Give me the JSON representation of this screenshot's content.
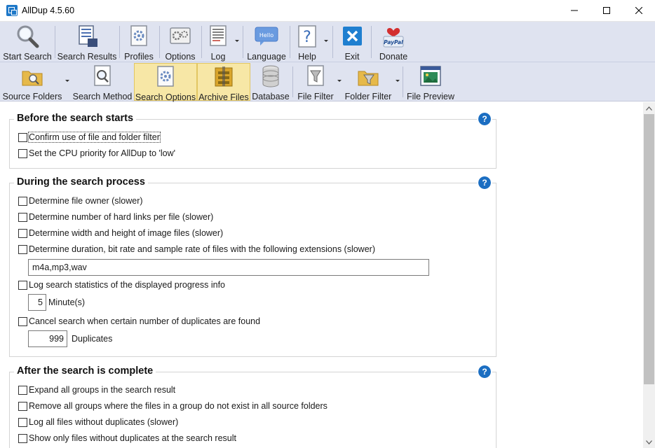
{
  "window": {
    "title": "AllDup 4.5.60"
  },
  "toolbar_main": [
    {
      "label": "Start Search",
      "icon": "magnifier-icon"
    },
    {
      "label": "Search Results",
      "icon": "search-results-icon"
    },
    {
      "label": "Profiles",
      "icon": "profiles-icon"
    },
    {
      "label": "Options",
      "icon": "options-icon"
    },
    {
      "label": "Log",
      "icon": "log-icon"
    },
    {
      "label": "Language",
      "icon": "language-icon",
      "bubble_text": "Hello"
    },
    {
      "label": "Help",
      "icon": "help-icon"
    },
    {
      "label": "Exit",
      "icon": "exit-icon"
    },
    {
      "label": "Donate",
      "icon": "donate-icon",
      "badge_text": "PayPal"
    }
  ],
  "toolbar_secondary": [
    {
      "label": "Source Folders",
      "icon": "source-folders-icon",
      "active": false
    },
    {
      "label": "Search Method",
      "icon": "search-method-icon",
      "active": false
    },
    {
      "label": "Search Options",
      "icon": "search-options-icon",
      "active": true
    },
    {
      "label": "Archive Files",
      "icon": "archive-files-icon",
      "active": true
    },
    {
      "label": "Database",
      "icon": "database-icon",
      "active": false
    },
    {
      "label": "File Filter",
      "icon": "file-filter-icon",
      "active": false
    },
    {
      "label": "Folder Filter",
      "icon": "folder-filter-icon",
      "active": false
    },
    {
      "label": "File Preview",
      "icon": "file-preview-icon",
      "active": false
    }
  ],
  "sections": {
    "before": {
      "title": "Before the search starts",
      "help": "?",
      "options": [
        {
          "label": "Confirm use of file and folder filter",
          "checked": false
        },
        {
          "label": "Set the CPU priority for AllDup to 'low'",
          "checked": false
        }
      ]
    },
    "during": {
      "title": "During the search process",
      "help": "?",
      "options": [
        {
          "label": "Determine file owner (slower)",
          "checked": false
        },
        {
          "label": "Determine number of hard links per file (slower)",
          "checked": false
        },
        {
          "label": "Determine width and height of image files (slower)",
          "checked": false
        },
        {
          "label": "Determine duration, bit rate and sample rate of files with the following extensions (slower)",
          "checked": false
        },
        {
          "label": "Log search statistics of the displayed progress info",
          "checked": false
        },
        {
          "label": "Cancel search when certain number of duplicates are found",
          "checked": false
        }
      ],
      "extensions_value": "m4a,mp3,wav",
      "log_interval_value": "5",
      "log_interval_unit": "Minute(s)",
      "duplicates_value": "999",
      "duplicates_unit": "Duplicates"
    },
    "after": {
      "title": "After the search is complete",
      "help": "?",
      "options": [
        {
          "label": "Expand all groups in the search result",
          "checked": false
        },
        {
          "label": "Remove all groups where the files in a group do not exist in all source folders",
          "checked": false
        },
        {
          "label": "Log all files without duplicates (slower)",
          "checked": false
        },
        {
          "label": "Show only files without duplicates at the search result",
          "checked": false
        }
      ]
    }
  },
  "colors": {
    "toolbar_bg": "#dfe3f0",
    "active_bg": "#f7e7a6",
    "help_blue": "#1b6ec2",
    "exit_blue": "#1f7fd0"
  }
}
